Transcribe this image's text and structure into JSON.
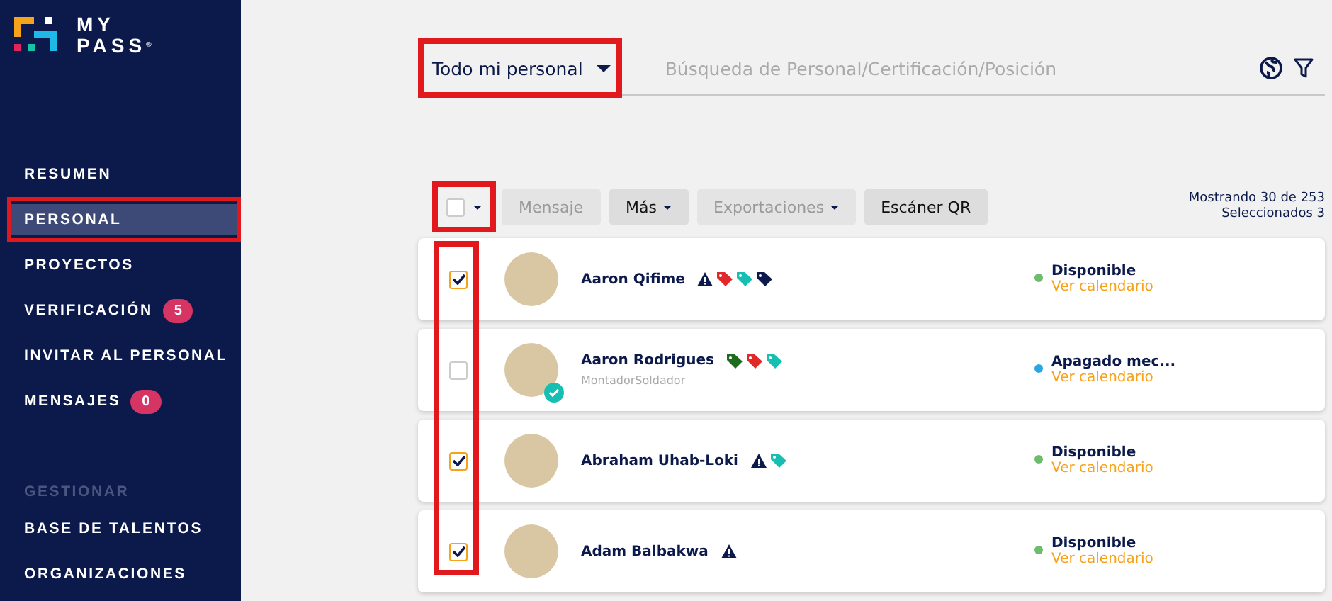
{
  "logo": {
    "line1": "MY",
    "line2": "PASS",
    "mark": "®"
  },
  "sidebar": {
    "items": [
      {
        "label": "RESUMEN",
        "selected": false
      },
      {
        "label": "PERSONAL",
        "selected": true,
        "highlighted": true
      },
      {
        "label": "PROYECTOS",
        "selected": false
      },
      {
        "label": "VERIFICACIÓN",
        "selected": false,
        "badge": "5"
      },
      {
        "label": "INVITAR AL PERSONAL",
        "selected": false
      },
      {
        "label": "MENSAJES",
        "selected": false,
        "badge": "0"
      }
    ],
    "section_title": "GESTIONAR",
    "section_items": [
      {
        "label": "BASE DE TALENTOS",
        "selected": false
      },
      {
        "label": "ORGANIZACIONES",
        "selected": false
      }
    ]
  },
  "filter": {
    "dropdown": "Todo mi personal",
    "highlighted": true,
    "search_placeholder": "Búsqueda de Personal/Certificación/Posición"
  },
  "actions": {
    "select_all": {
      "checked": false,
      "highlighted": true
    },
    "buttons": [
      {
        "label": "Mensaje",
        "disabled": true,
        "caret": false
      },
      {
        "label": "Más",
        "disabled": false,
        "caret": true
      },
      {
        "label": "Exportaciones",
        "disabled": true,
        "caret": true
      },
      {
        "label": "Escáner QR",
        "disabled": false,
        "caret": false
      }
    ],
    "count": "Mostrando 30 de 253",
    "selected_count": "Seleccionados 3"
  },
  "checkbox_column_highlighted": true,
  "people": [
    {
      "name": "Aaron Qifime",
      "checked": true,
      "verified": false,
      "tags": [
        {
          "kind": "warning",
          "color": "#0c1a4b"
        },
        {
          "kind": "tag",
          "color": "#e02a2a"
        },
        {
          "kind": "tag",
          "color": "#17bfb3"
        },
        {
          "kind": "tag",
          "color": "#0c1a4b"
        }
      ],
      "status": "Disponible",
      "color": "#6dbb6d",
      "link": "Ver calendario"
    },
    {
      "name": "Aaron Rodrigues",
      "checked": false,
      "verified": true,
      "role": "MontadorSoldador",
      "tags": [
        {
          "kind": "tag",
          "color": "#1e6b1e"
        },
        {
          "kind": "tag",
          "color": "#e02a2a"
        },
        {
          "kind": "tag",
          "color": "#17bfb3"
        }
      ],
      "status": "Apagado mec...",
      "color": "#2aa7e0",
      "link": "Ver calendario"
    },
    {
      "name": "Abraham Uhab-Loki",
      "checked": true,
      "verified": false,
      "tags": [
        {
          "kind": "warning",
          "color": "#0c1a4b"
        },
        {
          "kind": "tag",
          "color": "#17bfb3"
        }
      ],
      "status": "Disponible",
      "color": "#6dbb6d",
      "link": "Ver calendario"
    },
    {
      "name": "Adam Balbakwa",
      "checked": true,
      "verified": false,
      "tags": [
        {
          "kind": "warning",
          "color": "#0c1a4b"
        }
      ],
      "status": "Disponible",
      "color": "#6dbb6d",
      "link": "Ver calendario"
    }
  ]
}
